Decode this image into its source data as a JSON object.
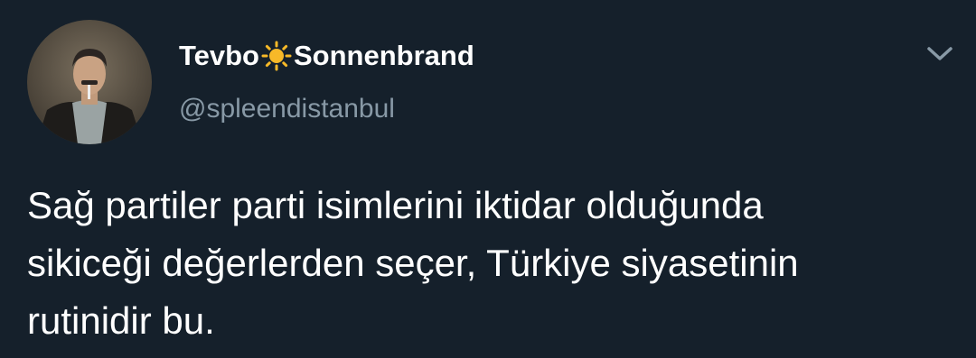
{
  "author": {
    "name_part1": "Tevbo",
    "name_emoji": "sun",
    "name_part2": "Sonnenbrand",
    "handle": "@spleendistanbul"
  },
  "tweet": {
    "lines": [
      "Sağ partiler parti isimlerini iktidar olduğunda",
      "sikiceği değerlerden seçer, Türkiye siyasetinin",
      "rutinidir bu."
    ]
  },
  "icons": {
    "menu": "chevron-down-icon",
    "emoji": "sun-icon"
  },
  "colors": {
    "background": "#15202b",
    "text": "#ffffff",
    "secondary": "#8899a6",
    "sun": "#f7b928"
  }
}
